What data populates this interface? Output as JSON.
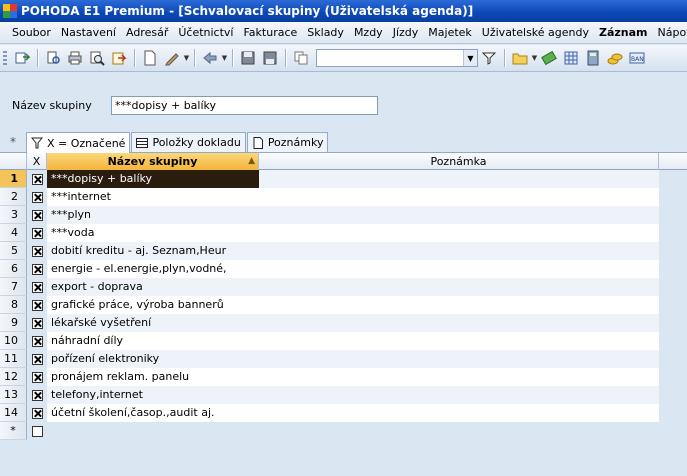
{
  "window": {
    "title": "POHODA E1 Premium - [Schvalovací skupiny (Uživatelská agenda)]"
  },
  "menu": [
    {
      "label": "Soubor",
      "bold": false
    },
    {
      "label": "Nastavení",
      "bold": false
    },
    {
      "label": "Adresář",
      "bold": false
    },
    {
      "label": "Účetnictví",
      "bold": false
    },
    {
      "label": "Fakturace",
      "bold": false
    },
    {
      "label": "Sklady",
      "bold": false
    },
    {
      "label": "Mzdy",
      "bold": false
    },
    {
      "label": "Jízdy",
      "bold": false
    },
    {
      "label": "Majetek",
      "bold": false
    },
    {
      "label": "Uživatelské agendy",
      "bold": false
    },
    {
      "label": "Záznam",
      "bold": true
    },
    {
      "label": "Nápově",
      "bold": false
    }
  ],
  "form": {
    "name_label": "Název skupiny",
    "name_value": "***dopisy + balíky"
  },
  "tabs": [
    {
      "label": "X = Označené",
      "icon": "funnel-icon"
    },
    {
      "label": "Položky dokladu",
      "icon": "table-icon"
    },
    {
      "label": "Poznámky",
      "icon": "note-icon"
    }
  ],
  "tabs_star": "*",
  "grid": {
    "columns": {
      "checked": "X",
      "name": "Název skupiny",
      "note": "Poznámka"
    },
    "rows": [
      {
        "num": "1",
        "checked": true,
        "name": "***dopisy + balíky"
      },
      {
        "num": "2",
        "checked": true,
        "name": "***internet"
      },
      {
        "num": "3",
        "checked": true,
        "name": "***plyn"
      },
      {
        "num": "4",
        "checked": true,
        "name": "***voda"
      },
      {
        "num": "5",
        "checked": true,
        "name": "dobití kreditu - aj. Seznam,Heur"
      },
      {
        "num": "6",
        "checked": true,
        "name": "energie - el.energie,plyn,vodné,"
      },
      {
        "num": "7",
        "checked": true,
        "name": "export - doprava"
      },
      {
        "num": "8",
        "checked": true,
        "name": "grafické práce, výroba bannerů"
      },
      {
        "num": "9",
        "checked": true,
        "name": "lékařské vyšetření"
      },
      {
        "num": "10",
        "checked": true,
        "name": "náhradní díly"
      },
      {
        "num": "11",
        "checked": true,
        "name": "pořízení elektroniky"
      },
      {
        "num": "12",
        "checked": true,
        "name": "pronájem reklam. panelu"
      },
      {
        "num": "13",
        "checked": true,
        "name": "telefony,internet"
      },
      {
        "num": "14",
        "checked": true,
        "name": "účetní školení,časop.,audit aj."
      }
    ],
    "new_row_marker": "*",
    "selected_row": 0
  },
  "colors": {
    "titlebar": "#0a47b8",
    "selected_cell": "#2b1d0e",
    "header_sorted": "#f3b53c",
    "background": "#dbe6f3"
  }
}
